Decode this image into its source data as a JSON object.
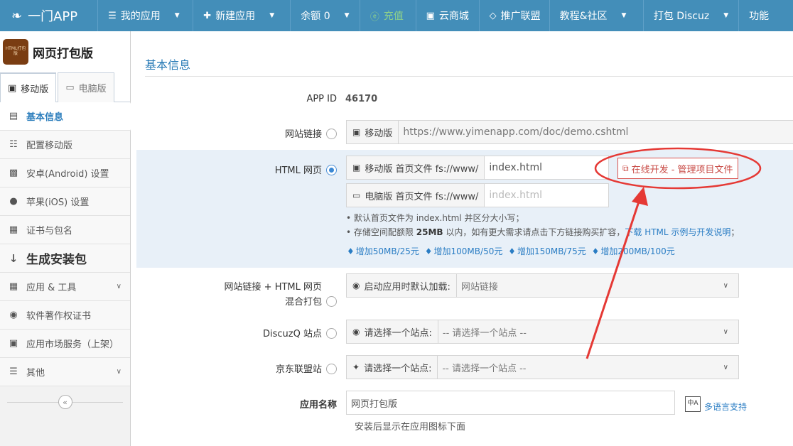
{
  "topnav": {
    "brand": "一门APP",
    "items": [
      {
        "icon": "list-icon",
        "label": "我的应用",
        "dropdown": true
      },
      {
        "icon": "plus-icon",
        "label": "新建应用",
        "dropdown": true
      },
      {
        "icon": "",
        "label": "余额 0",
        "dropdown": true
      },
      {
        "icon": "yen-icon",
        "label": "充值",
        "dropdown": false
      },
      {
        "icon": "shop-icon",
        "label": "云商城",
        "dropdown": false
      },
      {
        "icon": "diamond-icon",
        "label": "推广联盟",
        "dropdown": false
      },
      {
        "icon": "",
        "label": "教程&社区",
        "dropdown": true
      },
      {
        "icon": "",
        "label": "打包 Discuz",
        "dropdown": true
      },
      {
        "icon": "",
        "label": "功能",
        "dropdown": false
      }
    ]
  },
  "sidebar": {
    "app_logo_text": "HTML打包版",
    "app_name": "网页打包版",
    "tabs": [
      {
        "icon": "mobile-icon",
        "label": "移动版",
        "active": true
      },
      {
        "icon": "desktop-icon",
        "label": "电脑版",
        "active": false
      }
    ],
    "menu": [
      {
        "icon": "list-alt-icon",
        "label": "基本信息",
        "active": true
      },
      {
        "icon": "sliders-icon",
        "label": "配置移动版"
      },
      {
        "icon": "android-icon",
        "label": "安卓(Android) 设置"
      },
      {
        "icon": "apple-icon",
        "label": "苹果(iOS) 设置"
      },
      {
        "icon": "certificate-icon",
        "label": "证书与包名"
      },
      {
        "icon": "sort-numeric-icon",
        "label": "生成安装包",
        "big": true
      },
      {
        "icon": "apps-icon",
        "label": "应用 & 工具",
        "expandable": true
      },
      {
        "icon": "copyright-icon",
        "label": "软件著作权证书"
      },
      {
        "icon": "store-icon",
        "label": "应用市场服务（上架）"
      },
      {
        "icon": "bars-icon",
        "label": "其他",
        "expandable": true
      }
    ]
  },
  "main": {
    "section_title": "基本信息",
    "app_id_label": "APP ID",
    "app_id_value": "46170",
    "website_link": {
      "label": "网站链接",
      "addon": "移动版",
      "value": "https://www.yimenapp.com/doc/demo.cshtml"
    },
    "html_page": {
      "label": "HTML 网页",
      "selected": true,
      "mobile_addon": "移动版 首页文件 fs://www/",
      "mobile_value": "index.html",
      "desktop_addon": "电脑版 首页文件 fs://www/",
      "desktop_placeholder": "index.html",
      "online_dev_button": "在线开发 - 管理项目文件",
      "note1": "默认首页文件为 index.html 并区分大小写；",
      "note2_prefix": "存储空间配额限",
      "note2_bold": "25MB",
      "note2_middle": "以内，如有更大需求请点击下方链接购买扩容，",
      "note2_link": "下载 HTML 示例与开发说明",
      "note2_suffix": "；",
      "buy_options": [
        "增加50MB/25元",
        "增加100MB/50元",
        "增加150MB/75元",
        "增加200MB/100元"
      ]
    },
    "mixed": {
      "label_line1": "网站链接 + HTML 网页",
      "label_line2": "混合打包",
      "addon": "启动应用时默认加载:",
      "value": "网站链接"
    },
    "discuzq": {
      "label": "DiscuzQ 站点",
      "addon": "请选择一个站点:",
      "value": "-- 请选择一个站点 --"
    },
    "jd": {
      "label": "京东联盟站",
      "addon": "请选择一个站点:",
      "value": "-- 请选择一个站点 --"
    },
    "app_name": {
      "label": "应用名称",
      "value": "网页打包版",
      "hint": "安装后显示在应用图标下面",
      "lang_link": "多语言支持"
    }
  },
  "annotation": {
    "ellipse_color": "#e53935",
    "arrow_color": "#e53935"
  }
}
